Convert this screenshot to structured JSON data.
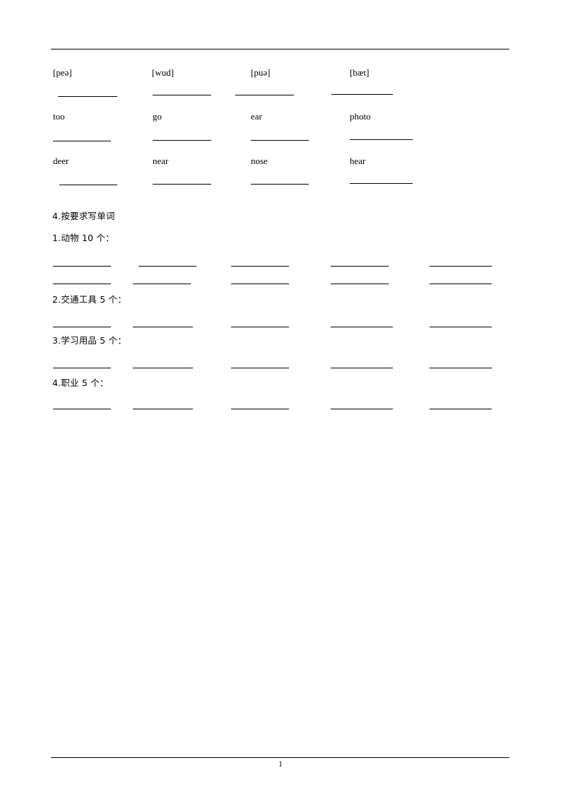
{
  "document": {
    "page_number": "1",
    "has_header_rule": true,
    "has_footer_rule": true
  },
  "phonetics_exercise": {
    "columns": [
      {
        "phonetic": "[peə]",
        "word_1": "too",
        "word_2": "deer"
      },
      {
        "phonetic": "[wud]",
        "word_1": "go",
        "word_2": "near"
      },
      {
        "phonetic": "[puə]",
        "word_1": "ear",
        "word_2": "nose"
      },
      {
        "phonetic": "[bæt]",
        "word_1": "photo",
        "word_2": "hear"
      }
    ]
  },
  "writing_exercise": {
    "title": "4.按要求写单词",
    "sections": [
      {
        "label": "1.动物 10 个：",
        "answer_blanks": 10
      },
      {
        "label": "2.交通工具 5 个：",
        "answer_blanks": 5
      },
      {
        "label": "3.学习用品 5 个：",
        "answer_blanks": 5
      },
      {
        "label": "4.职业 5 个：",
        "answer_blanks": 5
      }
    ]
  }
}
